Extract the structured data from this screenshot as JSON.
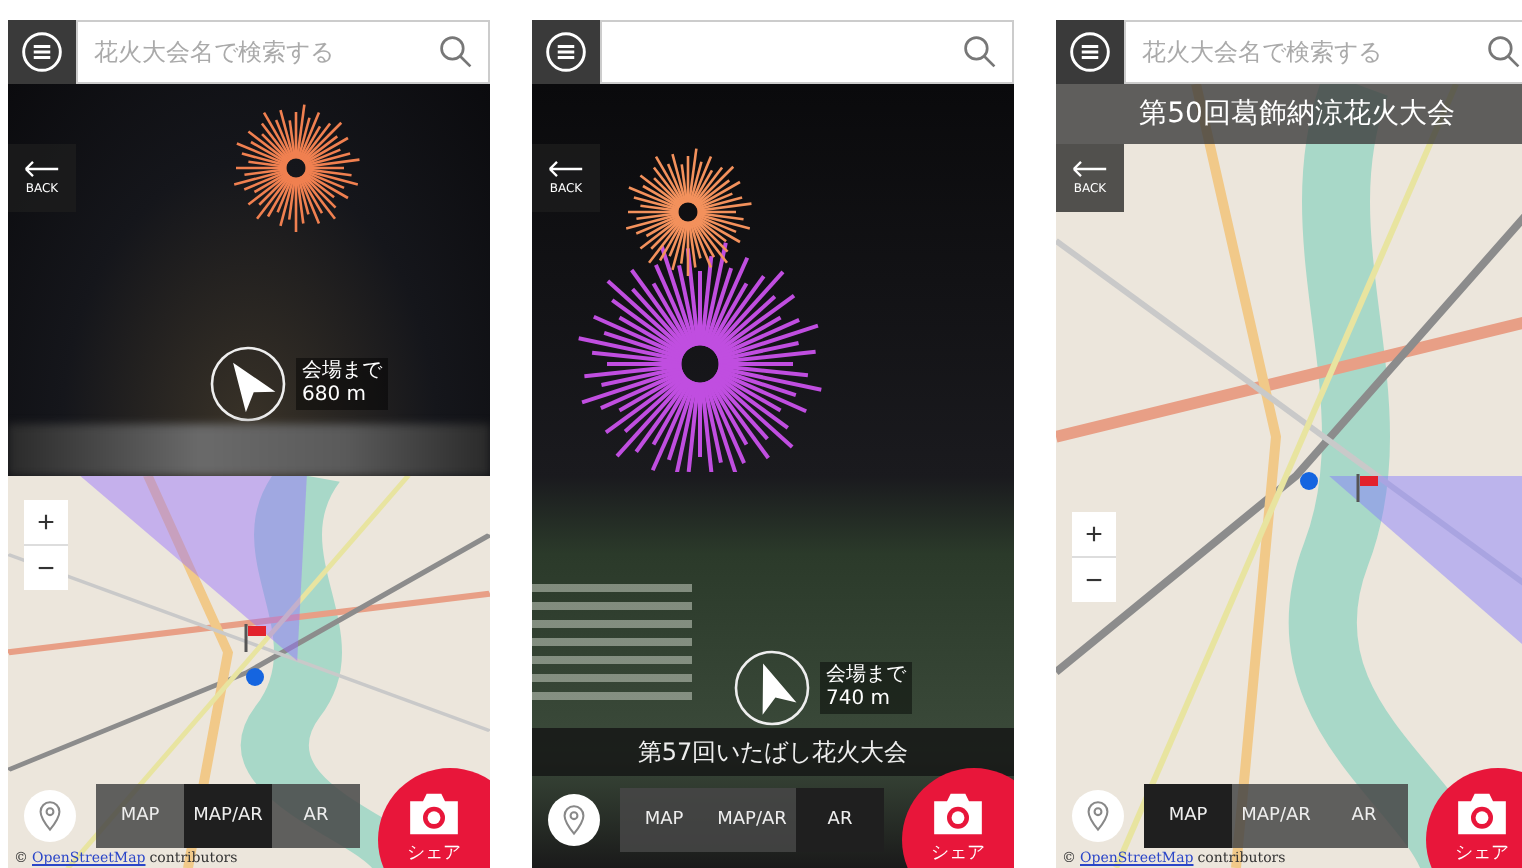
{
  "screens": [
    {
      "kind": "split",
      "search": {
        "placeholder": "花火大会名で検索する"
      },
      "back_label": "BACK",
      "distance": {
        "label": "会場まで",
        "value": "680 m"
      },
      "zoom": {
        "plus": "+",
        "minus": "−"
      },
      "modes": [
        {
          "label": "MAP",
          "selected": false
        },
        {
          "label": "MAP/AR",
          "selected": true
        },
        {
          "label": "AR",
          "selected": false
        }
      ],
      "share_label": "シェア",
      "attribution": {
        "prefix": "©",
        "link": "OpenStreetMap",
        "suffix": "contributors"
      }
    },
    {
      "kind": "ar",
      "back_label": "BACK",
      "distance": {
        "label": "会場まで",
        "value": "740 m"
      },
      "title": "第57回いたばし花火大会",
      "modes": [
        {
          "label": "MAP",
          "selected": false
        },
        {
          "label": "MAP/AR",
          "selected": false
        },
        {
          "label": "AR",
          "selected": true
        }
      ],
      "share_label": "シェア"
    },
    {
      "kind": "map",
      "search": {
        "placeholder": "花火大会名で検索する"
      },
      "title": "第50回葛飾納涼花火大会",
      "back_label": "BACK",
      "zoom": {
        "plus": "+",
        "minus": "−"
      },
      "modes": [
        {
          "label": "MAP",
          "selected": true
        },
        {
          "label": "MAP/AR",
          "selected": false
        },
        {
          "label": "AR",
          "selected": false
        }
      ],
      "share_label": "シェア",
      "attribution": {
        "prefix": "©",
        "link": "OpenStreetMap",
        "suffix": "contributors"
      }
    }
  ]
}
